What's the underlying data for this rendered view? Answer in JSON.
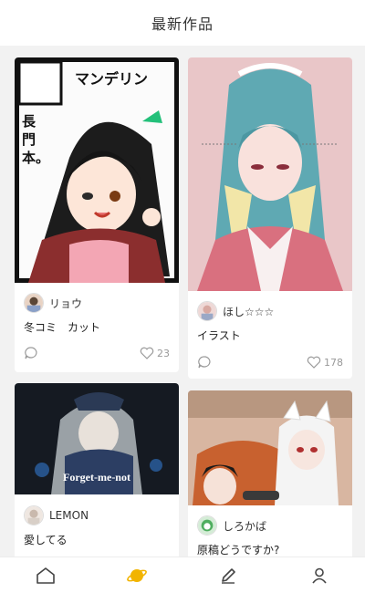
{
  "header": {
    "title": "最新作品"
  },
  "works": [
    {
      "user": "リョウ",
      "title": "冬コミ　カット",
      "likes": "23",
      "art_text": {
        "heading": "マンデリン",
        "vertical": "長門本。"
      }
    },
    {
      "user": "ほし☆☆☆",
      "title": "イラスト",
      "likes": "178"
    },
    {
      "user": "LEMON",
      "title": "愛してる",
      "likes": "",
      "art_text": {
        "overlay": "Forget-me-not"
      }
    },
    {
      "user": "しろかば",
      "title": "原稿どうですか?",
      "likes": ""
    }
  ],
  "tabbar": {
    "items": [
      "home-icon",
      "planet-icon",
      "pencil-icon",
      "profile-icon"
    ],
    "active": "planet-icon",
    "active_color": "#f2b400",
    "inactive_color": "#444444"
  },
  "colors": {
    "like_gray": "#999999",
    "header_bg": "#ffffff"
  }
}
